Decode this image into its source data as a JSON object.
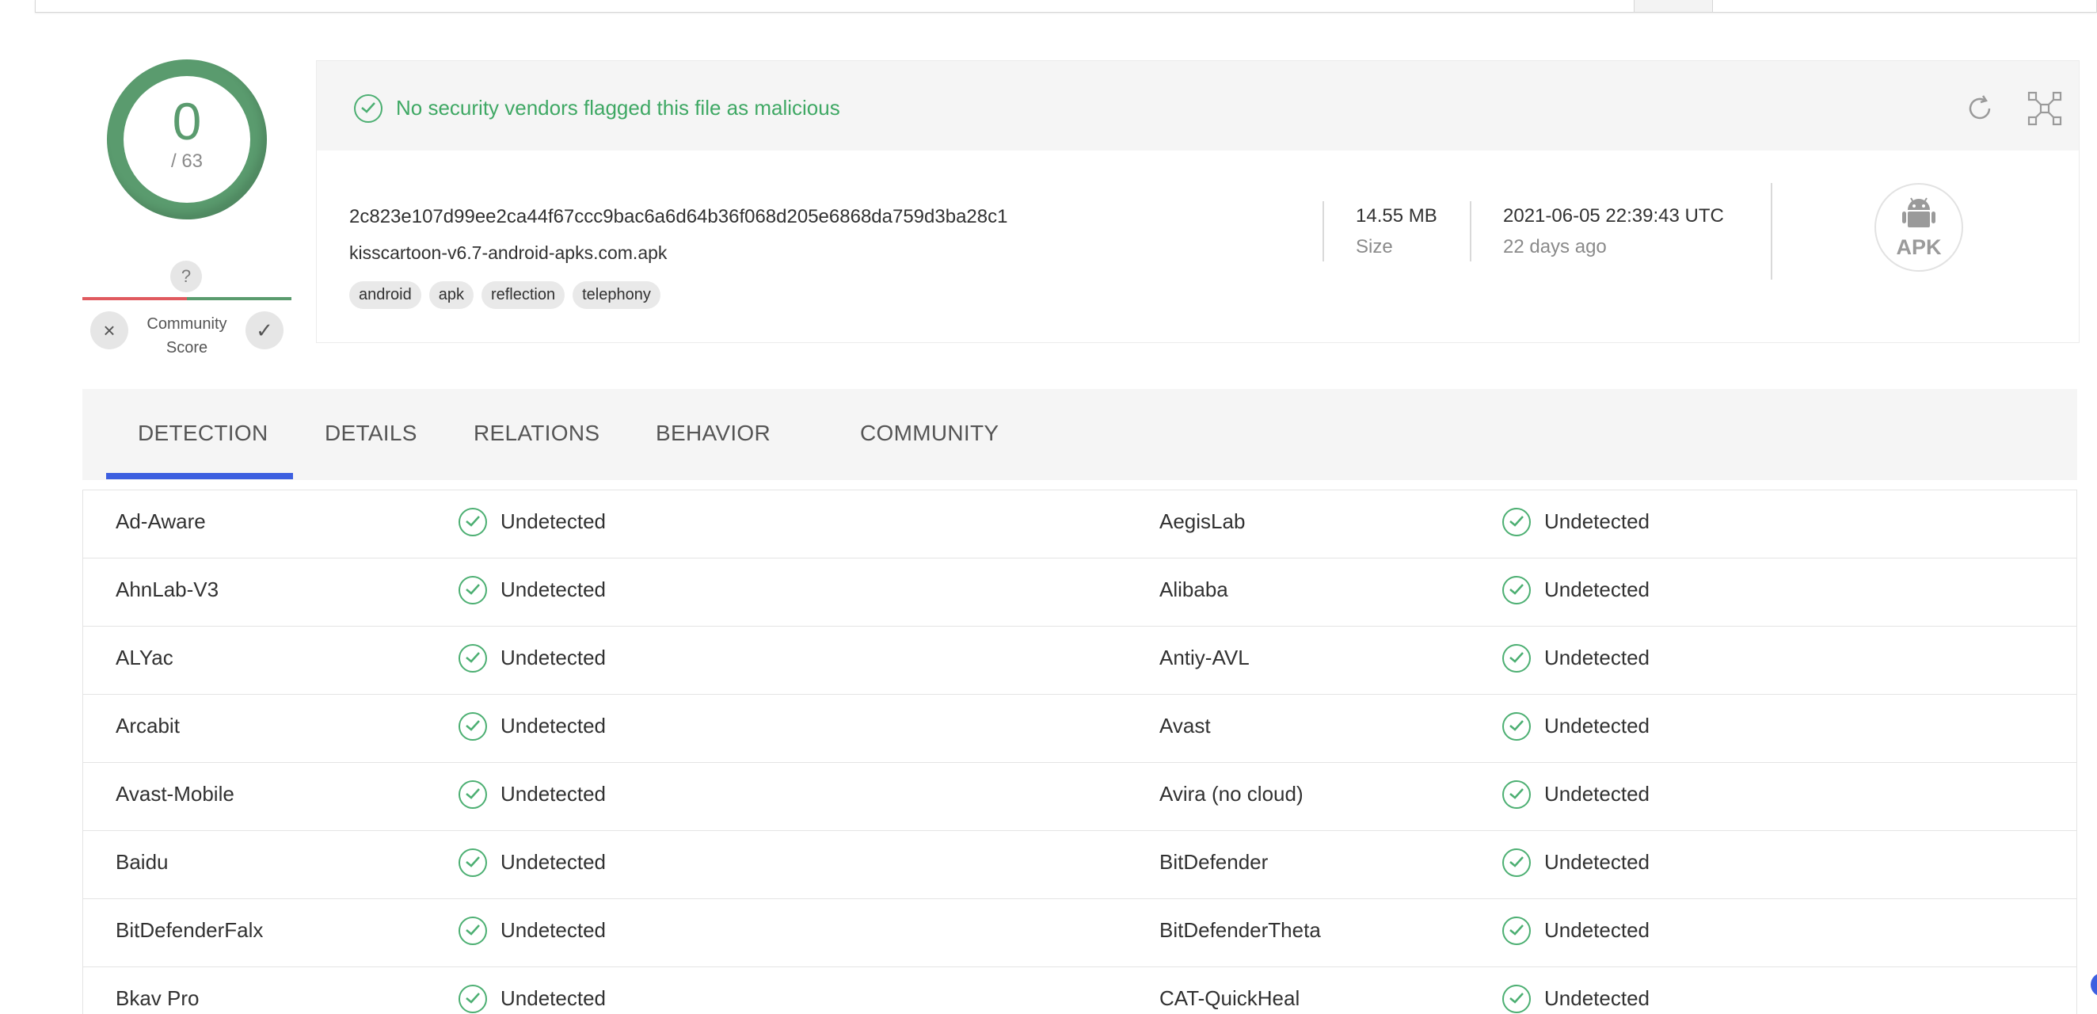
{
  "score": {
    "detections": "0",
    "total": "/ 63"
  },
  "community": {
    "unknown_icon": "?",
    "label_line1": "Community",
    "label_line2": "Score",
    "vote_down_icon": "×",
    "vote_up_icon": "✓"
  },
  "summary": {
    "status_message": "No security vendors flagged this file as malicious",
    "hash": "2c823e107d99ee2ca44f67ccc9bac6a6d64b36f068d205e6868da759d3ba28c1",
    "filename": "kisscartoon-v6.7-android-apks.com.apk",
    "tags": [
      "android",
      "apk",
      "reflection",
      "telephony"
    ],
    "size_value": "14.55 MB",
    "size_label": "Size",
    "date_value": "2021-06-05 22:39:43 UTC",
    "date_label": "22 days ago",
    "file_type": "APK"
  },
  "tabs": [
    "DETECTION",
    "DETAILS",
    "RELATIONS",
    "BEHAVIOR",
    "COMMUNITY"
  ],
  "detections": [
    {
      "left": {
        "engine": "Ad-Aware",
        "result": "Undetected"
      },
      "right": {
        "engine": "AegisLab",
        "result": "Undetected"
      }
    },
    {
      "left": {
        "engine": "AhnLab-V3",
        "result": "Undetected"
      },
      "right": {
        "engine": "Alibaba",
        "result": "Undetected"
      }
    },
    {
      "left": {
        "engine": "ALYac",
        "result": "Undetected"
      },
      "right": {
        "engine": "Antiy-AVL",
        "result": "Undetected"
      }
    },
    {
      "left": {
        "engine": "Arcabit",
        "result": "Undetected"
      },
      "right": {
        "engine": "Avast",
        "result": "Undetected"
      }
    },
    {
      "left": {
        "engine": "Avast-Mobile",
        "result": "Undetected"
      },
      "right": {
        "engine": "Avira (no cloud)",
        "result": "Undetected"
      }
    },
    {
      "left": {
        "engine": "Baidu",
        "result": "Undetected"
      },
      "right": {
        "engine": "BitDefender",
        "result": "Undetected"
      }
    },
    {
      "left": {
        "engine": "BitDefenderFalx",
        "result": "Undetected"
      },
      "right": {
        "engine": "BitDefenderTheta",
        "result": "Undetected"
      }
    },
    {
      "left": {
        "engine": "Bkav Pro",
        "result": "Undetected"
      },
      "right": {
        "engine": "CAT-QuickHeal",
        "result": "Undetected"
      }
    }
  ],
  "colors": {
    "clean_green": "#4caf72",
    "score_green": "#5a9b6e",
    "accent_blue": "#3d5fe0",
    "negative_red": "#e05a5f"
  },
  "icons": {
    "status": "check-circle-icon",
    "reanalyze": "refresh-icon",
    "graph": "graph-view-icon",
    "file_type": "android-apk-icon"
  }
}
